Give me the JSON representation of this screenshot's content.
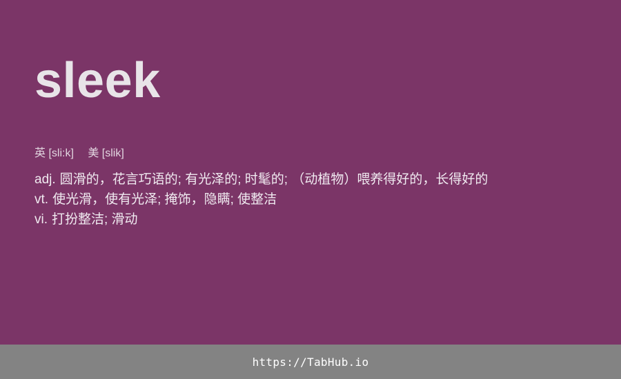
{
  "entry": {
    "word": "sleek",
    "phonetics": {
      "uk": "英 [sli:k]",
      "us": "美 [slik]"
    },
    "definitions": [
      {
        "pos": "adj.",
        "meaning": "圆滑的，花言巧语的; 有光泽的; 时髦的; （动植物）喂养得好的，长得好的"
      },
      {
        "pos": "vt.",
        "meaning": "使光滑，使有光泽; 掩饰，隐瞒; 使整洁"
      },
      {
        "pos": "vi.",
        "meaning": "打扮整洁; 滑动"
      }
    ]
  },
  "footer": {
    "link_text": "https://TabHub.io"
  },
  "colors": {
    "background": "#7b3567",
    "footer_background": "#838383",
    "text": "#ece6ec"
  }
}
